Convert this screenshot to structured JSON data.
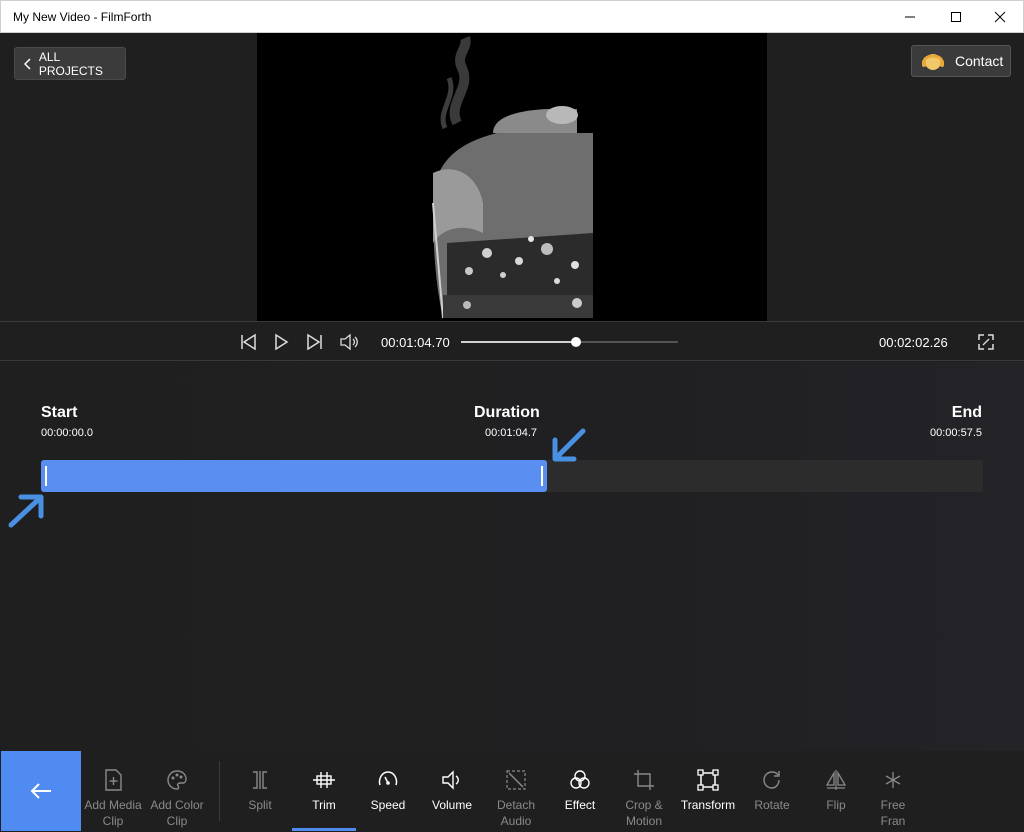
{
  "window": {
    "title": "My New Video - FilmForth"
  },
  "header": {
    "all_projects": "ALL PROJECTS",
    "contact": "Contact"
  },
  "player": {
    "current_time": "00:01:04.70",
    "total_time": "00:02:02.26",
    "progress": 0.53
  },
  "trim": {
    "start_label": "Start",
    "start_value": "00:00:00.0",
    "duration_label": "Duration",
    "duration_value": "00:01:04.7",
    "end_label": "End",
    "end_value": "00:00:57.5",
    "selection_fraction": 0.537,
    "selection_color": "#5a8ef0",
    "arrow_color": "#4a90e2"
  },
  "toolbar": {
    "accent": "#4f8bf0",
    "back_icon": "arrow-left-icon",
    "items": [
      {
        "label": "Add Media\nClip",
        "icon": "add-media-icon",
        "enabled": false
      },
      {
        "label": "Add Color\nClip",
        "icon": "palette-icon",
        "enabled": false
      },
      {
        "label": "Split",
        "icon": "split-icon",
        "enabled": false
      },
      {
        "label": "Trim",
        "icon": "trim-icon",
        "enabled": true,
        "active": true
      },
      {
        "label": "Speed",
        "icon": "speedometer-icon",
        "enabled": true
      },
      {
        "label": "Volume",
        "icon": "speaker-icon",
        "enabled": true
      },
      {
        "label": "Detach\nAudio",
        "icon": "detach-audio-icon",
        "enabled": false
      },
      {
        "label": "Effect",
        "icon": "effect-icon",
        "enabled": true
      },
      {
        "label": "Crop &\nMotion",
        "icon": "crop-icon",
        "enabled": false
      },
      {
        "label": "Transform",
        "icon": "transform-icon",
        "enabled": true
      },
      {
        "label": "Rotate",
        "icon": "rotate-icon",
        "enabled": false
      },
      {
        "label": "Flip",
        "icon": "flip-icon",
        "enabled": false
      },
      {
        "label": "Free\nFran",
        "icon": "snowflake-icon",
        "enabled": false
      }
    ]
  }
}
